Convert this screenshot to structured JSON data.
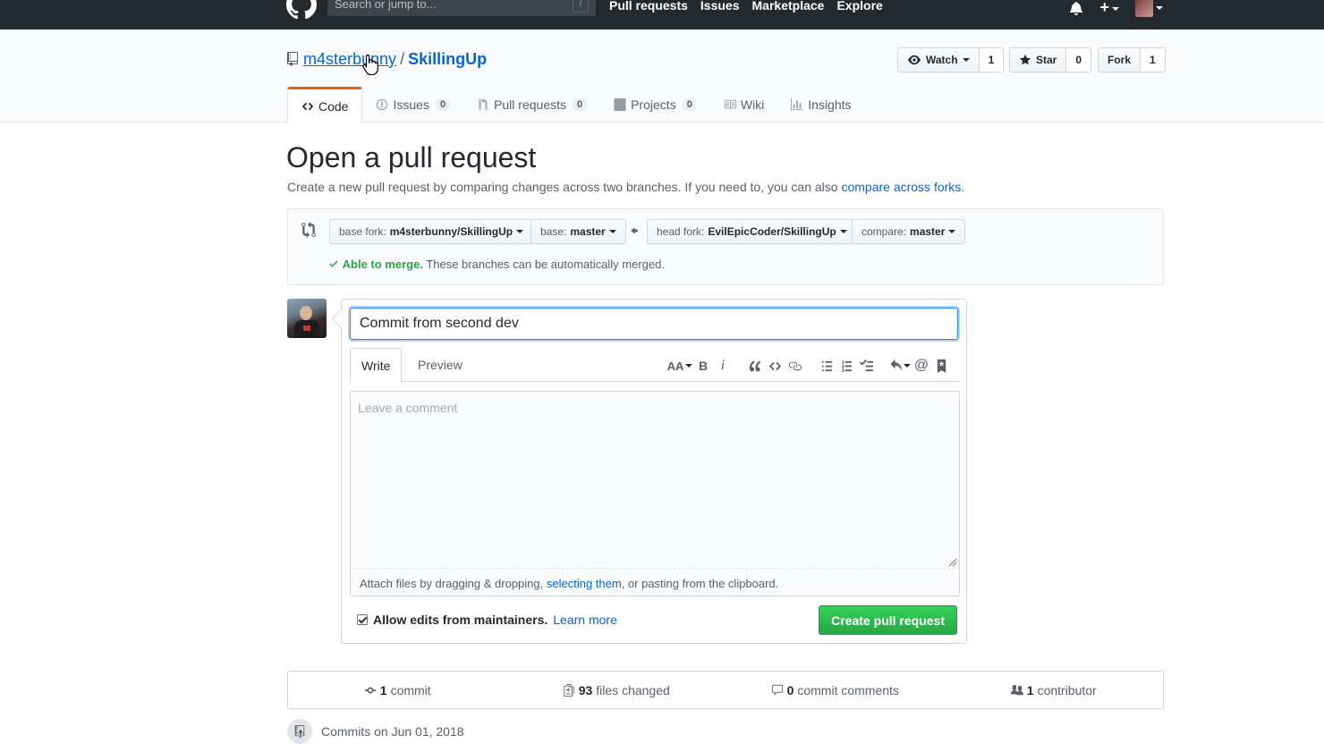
{
  "header": {
    "search_placeholder": "Search or jump to...",
    "slash_hint": "/",
    "nav": [
      "Pull requests",
      "Issues",
      "Marketplace",
      "Explore"
    ]
  },
  "repo": {
    "owner": "m4sterbunny",
    "separator": "/",
    "name": "SkillingUp",
    "watch_label": "Watch",
    "watch_count": "1",
    "star_label": "Star",
    "star_count": "0",
    "fork_label": "Fork",
    "fork_count": "1"
  },
  "tabs": [
    {
      "label": "Code",
      "count": ""
    },
    {
      "label": "Issues",
      "count": "0"
    },
    {
      "label": "Pull requests",
      "count": "0"
    },
    {
      "label": "Projects",
      "count": "0"
    },
    {
      "label": "Wiki",
      "count": ""
    },
    {
      "label": "Insights",
      "count": ""
    }
  ],
  "page": {
    "title": "Open a pull request",
    "description": "Create a new pull request by comparing changes across two branches. If you need to, you can also",
    "description_link": "compare across forks."
  },
  "range": {
    "base_fork_prefix": "base fork:",
    "base_fork": "m4sterbunny/SkillingUp",
    "base_prefix": "base:",
    "base": "master",
    "head_fork_prefix": "head fork:",
    "head_fork": "EvilEpicCoder/SkillingUp",
    "compare_prefix": "compare:",
    "compare": "master",
    "merge_ok": "Able to merge.",
    "merge_msg": "These branches can be automatically merged."
  },
  "form": {
    "title_value": "Commit from second dev",
    "write_tab": "Write",
    "preview_tab": "Preview",
    "comment_placeholder": "Leave a comment",
    "attach_prefix": "Attach files by dragging & dropping,",
    "attach_link": "selecting them",
    "attach_suffix": ", or pasting from the clipboard.",
    "allow_edits": "Allow edits from maintainers.",
    "learn_more": "Learn more",
    "submit_label": "Create pull request",
    "allow_edits_checked": true
  },
  "summary": {
    "commits_count": "1",
    "commits_label": "commit",
    "files_count": "93",
    "files_label": "files changed",
    "comments_count": "0",
    "comments_label": "commit comments",
    "contributors_count": "1",
    "contributors_label": "contributor"
  },
  "commits_heading": "Commits on Jun 01, 2018",
  "colors": {
    "header_bg": "#24292e",
    "link": "#0366d6",
    "success": "#28a745",
    "tab_accent": "#e36209"
  }
}
